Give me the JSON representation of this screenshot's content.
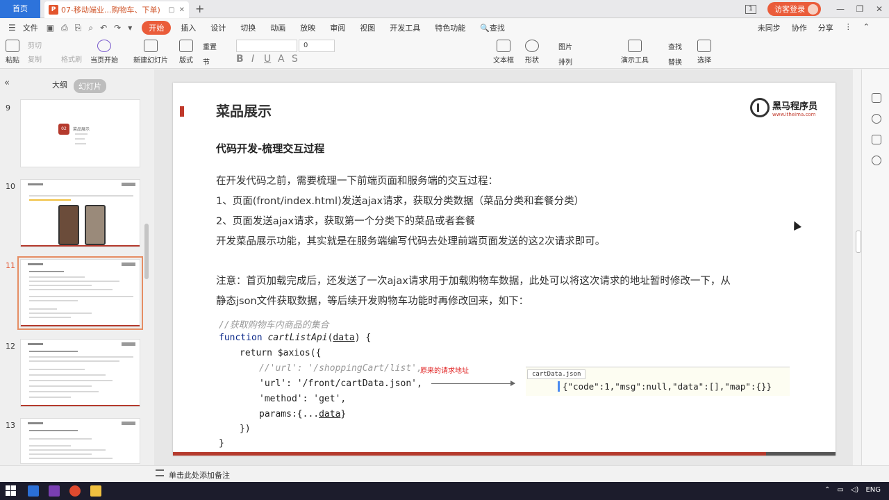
{
  "tabbar": {
    "home_label": "首页",
    "doc_tab_title": "07-移动端业...购物车、下单)",
    "new_tab_symbol": "+",
    "visitor_label": "访客登录",
    "box_count": "1"
  },
  "menubar": {
    "items": [
      "文件",
      "开始",
      "插入",
      "设计",
      "切换",
      "动画",
      "放映",
      "审阅",
      "视图",
      "开发工具",
      "特色功能"
    ],
    "search_label": "查找",
    "right": [
      "未同步",
      "协作",
      "分享"
    ]
  },
  "ribbon": {
    "paste": "粘贴",
    "cut": "剪切",
    "copy": "复制",
    "format_painter": "格式刷",
    "from_current": "当页开始",
    "new_slide": "新建幻灯片",
    "layout": "版式",
    "section": "节",
    "reset": "重置",
    "font_size": "0",
    "textbox": "文本框",
    "shape": "形状",
    "arrange": "排列",
    "picture": "图片",
    "present_tools": "演示工具",
    "find": "查找",
    "replace": "替换",
    "select": "选择"
  },
  "leftpanel": {
    "outline_tab": "大纲",
    "slides_tab": "幻灯片",
    "slide_numbers": [
      "9",
      "10",
      "11",
      "12",
      "13"
    ],
    "thumb9_title": "菜品展示",
    "thumb9_badge": "02"
  },
  "slide": {
    "title": "菜品展示",
    "logo_cn": "黑马程序员",
    "logo_url": "www.itheima.com",
    "subtitle": "代码开发-梳理交互过程",
    "para1": "在开发代码之前，需要梳理一下前端页面和服务端的交互过程：",
    "para2": "1、页面(front/index.html)发送ajax请求，获取分类数据（菜品分类和套餐分类）",
    "para3": "2、页面发送ajax请求，获取第一个分类下的菜品或者套餐",
    "para4": "开发菜品展示功能，其实就是在服务端编写代码去处理前端页面发送的这2次请求即可。",
    "note1": "注意：首页加载完成后，还发送了一次ajax请求用于加载购物车数据，此处可以将这次请求的地址暂时修改一下，从",
    "note2": "静态json文件获取数据，等后续开发购物车功能时再修改回来，如下：",
    "code_comment": "//获取购物车内商品的集合",
    "code_fn_kw": "function",
    "code_fn_name": "cartListApi",
    "code_fn_arg": "data",
    "code_fn_end": ") {",
    "code_return": "return $axios({",
    "code_old_url": "//'url': '/shoppingCart/list',",
    "code_old_label": "原来的请求地址",
    "code_url": "'url': '/front/cartData.json',",
    "code_method": "'method': 'get',",
    "code_params_pre": "params:{...",
    "code_params_data": "data",
    "code_params_end": "}",
    "code_close1": "})",
    "code_close2": "}",
    "json_tab": "cartData.json",
    "json_content": "{\"code\":1,\"msg\":null,\"data\":[],\"map\":{}}"
  },
  "notes": {
    "placeholder": "单击此处添加备注"
  },
  "taskbar": {
    "lang": "ENG"
  },
  "colors": {
    "accent": "#ea5c3a",
    "tab_home": "#2d73db",
    "brand_red": "#b53a2d"
  }
}
